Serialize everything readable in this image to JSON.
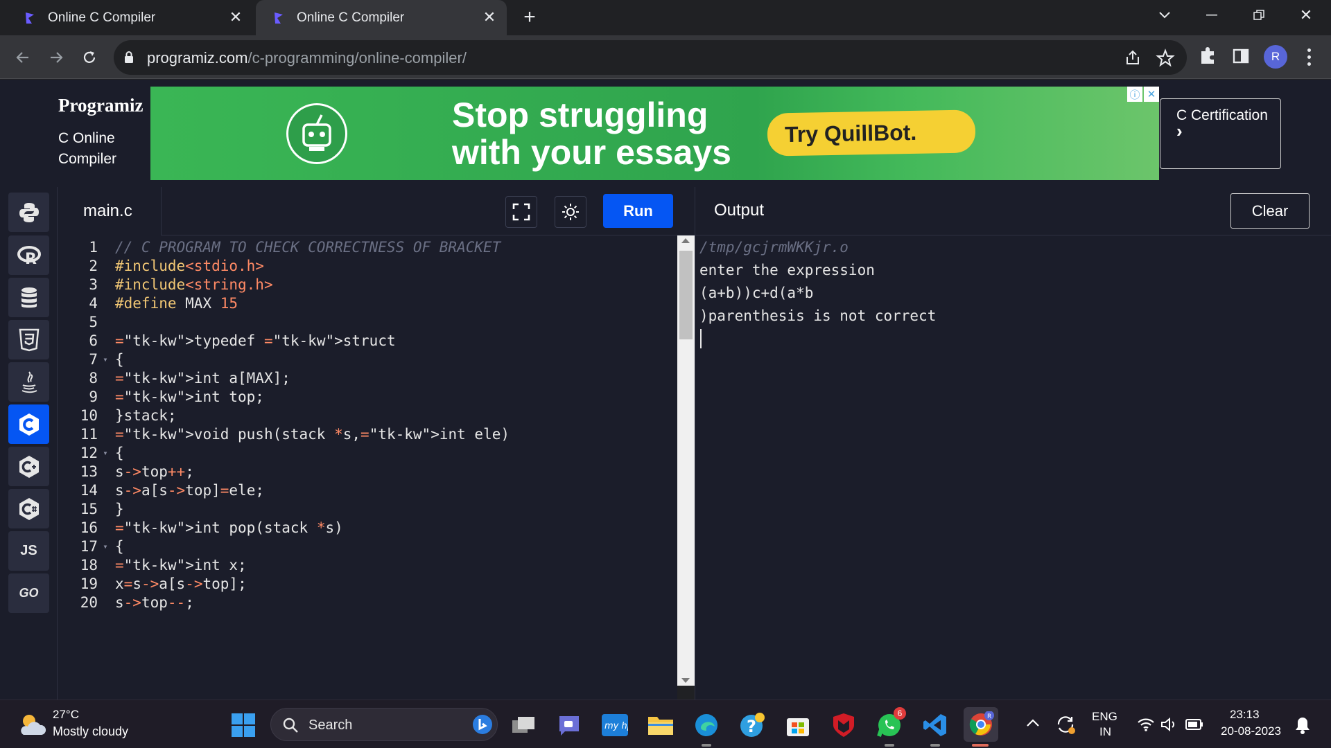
{
  "browser": {
    "tabs": [
      {
        "title": "Online C Compiler",
        "active": false
      },
      {
        "title": "Online C Compiler",
        "active": true
      }
    ],
    "url_host": "programiz.com",
    "url_path": "/c-programming/online-compiler/",
    "profile_initial": "R"
  },
  "header": {
    "logo": "Programiz",
    "subtitle": "C Online Compiler",
    "ad_headline_line1": "Stop struggling",
    "ad_headline_line2": "with your essays",
    "ad_cta": "Try QuillBot.",
    "certification": "C Certification",
    "certification_arrow": "›"
  },
  "sidebar": {
    "languages": [
      {
        "name": "python",
        "label": ""
      },
      {
        "name": "r",
        "label": "R"
      },
      {
        "name": "sql",
        "label": ""
      },
      {
        "name": "html",
        "label": "5"
      },
      {
        "name": "java",
        "label": ""
      },
      {
        "name": "c",
        "label": "C",
        "active": true
      },
      {
        "name": "cpp",
        "label": "C"
      },
      {
        "name": "csharp",
        "label": "C"
      },
      {
        "name": "javascript",
        "label": "JS"
      },
      {
        "name": "go",
        "label": "GO"
      }
    ]
  },
  "editor": {
    "filename": "main.c",
    "run_label": "Run",
    "lines": [
      {
        "n": "1",
        "fold": "",
        "text": "// C PROGRAM TO CHECK CORRECTNESS OF BRACKET"
      },
      {
        "n": "2",
        "fold": "",
        "text": "#include<stdio.h>"
      },
      {
        "n": "3",
        "fold": "",
        "text": "#include<string.h>"
      },
      {
        "n": "4",
        "fold": "",
        "text": "#define MAX 15"
      },
      {
        "n": "5",
        "fold": "",
        "text": ""
      },
      {
        "n": "6",
        "fold": "",
        "text": "typedef struct"
      },
      {
        "n": "7",
        "fold": "▾",
        "text": "{"
      },
      {
        "n": "8",
        "fold": "",
        "text": "int a[MAX];"
      },
      {
        "n": "9",
        "fold": "",
        "text": "int top;"
      },
      {
        "n": "10",
        "fold": "",
        "text": "}stack;"
      },
      {
        "n": "11",
        "fold": "",
        "text": "void push(stack *s,int ele)"
      },
      {
        "n": "12",
        "fold": "▾",
        "text": "{"
      },
      {
        "n": "13",
        "fold": "",
        "text": "s->top++;"
      },
      {
        "n": "14",
        "fold": "",
        "text": "s->a[s->top]=ele;"
      },
      {
        "n": "15",
        "fold": "",
        "text": "}"
      },
      {
        "n": "16",
        "fold": "",
        "text": "int pop(stack *s)"
      },
      {
        "n": "17",
        "fold": "▾",
        "text": "{"
      },
      {
        "n": "18",
        "fold": "",
        "text": "int x;"
      },
      {
        "n": "19",
        "fold": "",
        "text": "x=s->a[s->top];"
      },
      {
        "n": "20",
        "fold": "",
        "text": "s->top--;"
      }
    ]
  },
  "output": {
    "title": "Output",
    "clear_label": "Clear",
    "lines": [
      "/tmp/gcjrmWKKjr.o",
      "enter the expression",
      "(a+b))c+d(a*b",
      ")parenthesis is not correct"
    ]
  },
  "taskbar": {
    "temperature": "27°C",
    "condition": "Mostly cloudy",
    "search_label": "Search",
    "whatsapp_badge": "6",
    "language": "ENG",
    "region": "IN",
    "time": "23:13",
    "date": "20-08-2023"
  }
}
